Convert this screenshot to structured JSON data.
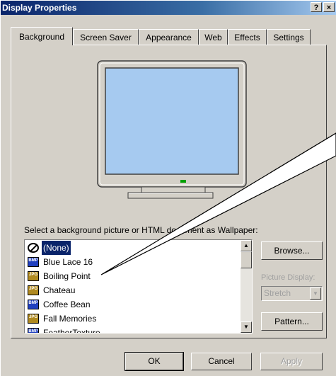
{
  "window": {
    "title": "Display Properties",
    "help_button": "?",
    "close_button": "×"
  },
  "tabs": [
    {
      "label": "Background"
    },
    {
      "label": "Screen Saver"
    },
    {
      "label": "Appearance"
    },
    {
      "label": "Web"
    },
    {
      "label": "Effects"
    },
    {
      "label": "Settings"
    }
  ],
  "wallpaper": {
    "label": "Select a background picture or HTML document as Wallpaper:",
    "items": [
      {
        "name": "(None)",
        "icon": "none-icon",
        "selected": true
      },
      {
        "name": "Blue Lace 16",
        "icon": "bmp-file-icon",
        "icon_text": "BMP"
      },
      {
        "name": "Boiling Point",
        "icon": "jpg-file-icon",
        "icon_text": "JPG"
      },
      {
        "name": "Chateau",
        "icon": "jpg-file-icon",
        "icon_text": "JPG"
      },
      {
        "name": "Coffee Bean",
        "icon": "bmp-file-icon",
        "icon_text": "BMP"
      },
      {
        "name": "Fall Memories",
        "icon": "jpg-file-icon",
        "icon_text": "JPG"
      },
      {
        "name": "FeatherTexture",
        "icon": "bmp-file-icon",
        "icon_text": "BMP"
      }
    ]
  },
  "buttons": {
    "browse": "Browse...",
    "pattern": "Pattern...",
    "ok": "OK",
    "cancel": "Cancel",
    "apply": "Apply"
  },
  "picture_display": {
    "label": "Picture Display:",
    "value": "Stretch"
  },
  "colors": {
    "title_bar": "#0a246a",
    "face": "#d4d0c8",
    "monitor_screen": "#a6caf0",
    "selection": "#0a246a"
  }
}
